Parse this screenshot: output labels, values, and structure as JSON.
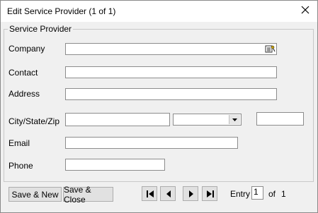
{
  "window": {
    "title": "Edit Service Provider (1 of 1)"
  },
  "group": {
    "legend": "Service Provider"
  },
  "labels": {
    "company": "Company",
    "contact": "Contact",
    "address": "Address",
    "city_state_zip": "City/State/Zip",
    "email": "Email",
    "phone": "Phone"
  },
  "fields": {
    "company": "",
    "contact": "",
    "address": "",
    "city": "",
    "state": "",
    "zip": "",
    "email": "",
    "phone": ""
  },
  "buttons": {
    "save_new": "Save & New",
    "save_close": "Save & Close"
  },
  "pager": {
    "entry_label": "Entry",
    "current": "1",
    "of_label": "of",
    "total": "1"
  },
  "icons": {
    "close": "close-icon",
    "company_lookup": "lookup-icon",
    "first": "first-record-icon",
    "prev": "previous-record-icon",
    "next": "next-record-icon",
    "last": "last-record-icon"
  }
}
